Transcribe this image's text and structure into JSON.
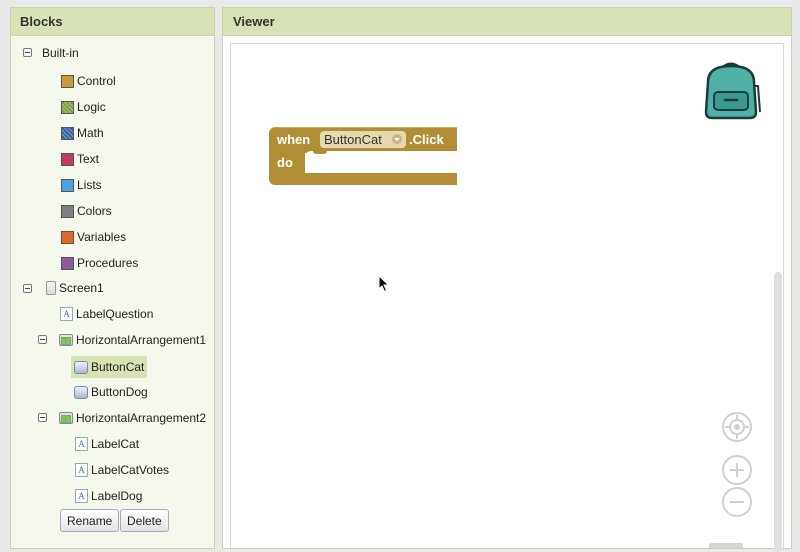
{
  "blocks_panel": {
    "title": "Blocks",
    "builtin": {
      "label": "Built-in",
      "items": [
        {
          "label": "Control",
          "color": "#c89c3a"
        },
        {
          "label": "Logic",
          "color": "#7fa23a"
        },
        {
          "label": "Math",
          "color": "#3a62a6"
        },
        {
          "label": "Text",
          "color": "#c13b61"
        },
        {
          "label": "Lists",
          "color": "#4aa3dc"
        },
        {
          "label": "Colors",
          "color": "#808080"
        },
        {
          "label": "Variables",
          "color": "#de6a2a"
        },
        {
          "label": "Procedures",
          "color": "#8e5a9b"
        }
      ]
    },
    "screen": {
      "label": "Screen1",
      "children": [
        {
          "label": "LabelQuestion",
          "icon": "label-icon"
        },
        {
          "label": "HorizontalArrangement1",
          "icon": "horizontal-arrangement-icon",
          "children": [
            {
              "label": "ButtonCat",
              "icon": "button-icon",
              "selected": true
            },
            {
              "label": "ButtonDog",
              "icon": "button-icon"
            }
          ]
        },
        {
          "label": "HorizontalArrangement2",
          "icon": "horizontal-arrangement-icon",
          "children": [
            {
              "label": "LabelCat",
              "icon": "label-icon"
            },
            {
              "label": "LabelCatVotes",
              "icon": "label-icon"
            },
            {
              "label": "LabelDog",
              "icon": "label-icon"
            }
          ]
        }
      ]
    },
    "rename_label": "Rename",
    "delete_label": "Delete"
  },
  "viewer": {
    "title": "Viewer",
    "event_block": {
      "when": "when",
      "component": "ButtonCat",
      "event": ".Click",
      "do": "do",
      "color": "#b18e35"
    },
    "label_icon_glyph": "A"
  }
}
